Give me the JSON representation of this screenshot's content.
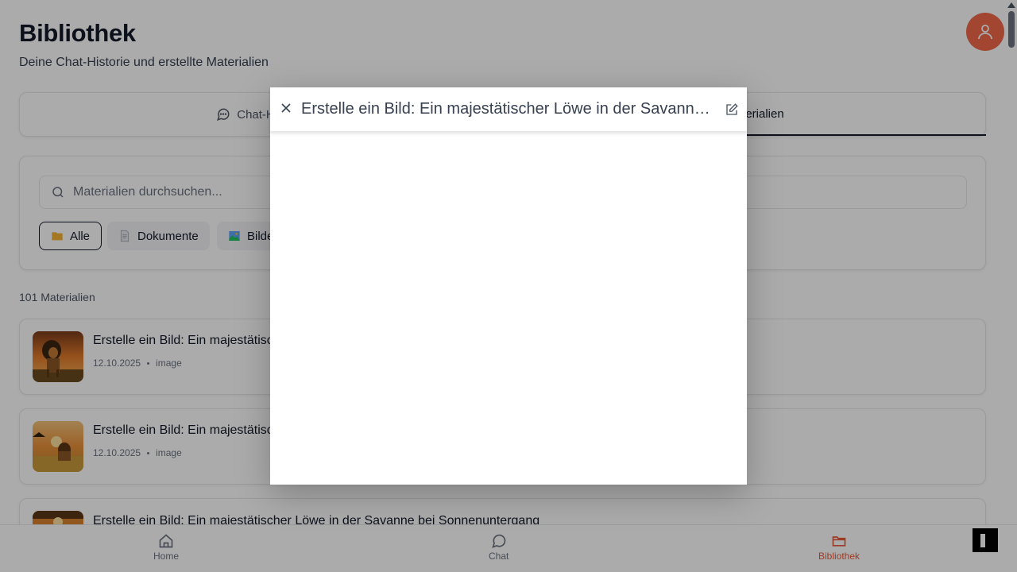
{
  "page": {
    "title": "Bibliothek",
    "subtitle": "Deine Chat-Historie und erstellte Materialien"
  },
  "tabs": {
    "history_label": "Chat-Historie",
    "materials_label": "Materialien"
  },
  "filters": {
    "search_placeholder": "Materialien durchsuchen...",
    "chips": [
      {
        "label": "Alle",
        "icon": "folder-icon"
      },
      {
        "label": "Dokumente",
        "icon": "document-icon"
      },
      {
        "label": "Bilder",
        "icon": "image-icon"
      }
    ]
  },
  "materials": {
    "count_label": "101 Materialien",
    "items": [
      {
        "title": "Erstelle ein Bild: Ein majestätischer Löwe in der Savanne bei Sonnenuntergang",
        "date": "12.10.2025",
        "type": "image"
      },
      {
        "title": "Erstelle ein Bild: Ein majestätischer Löwe in der Savanne bei Sonnenuntergang",
        "date": "12.10.2025",
        "type": "image"
      },
      {
        "title": "Erstelle ein Bild: Ein majestätischer Löwe in der Savanne bei Sonnenuntergang",
        "date": "",
        "type": ""
      }
    ]
  },
  "bottom_nav": {
    "home_label": "Home",
    "chat_label": "Chat",
    "library_label": "Bibliothek",
    "active_color": "#ea5a3a"
  },
  "modal": {
    "title": "Erstelle ein Bild: Ein majestätischer Löwe in der Savanne bei Sonnenuntergang"
  },
  "colors": {
    "accent": "#f26849",
    "text_primary": "#111827"
  }
}
